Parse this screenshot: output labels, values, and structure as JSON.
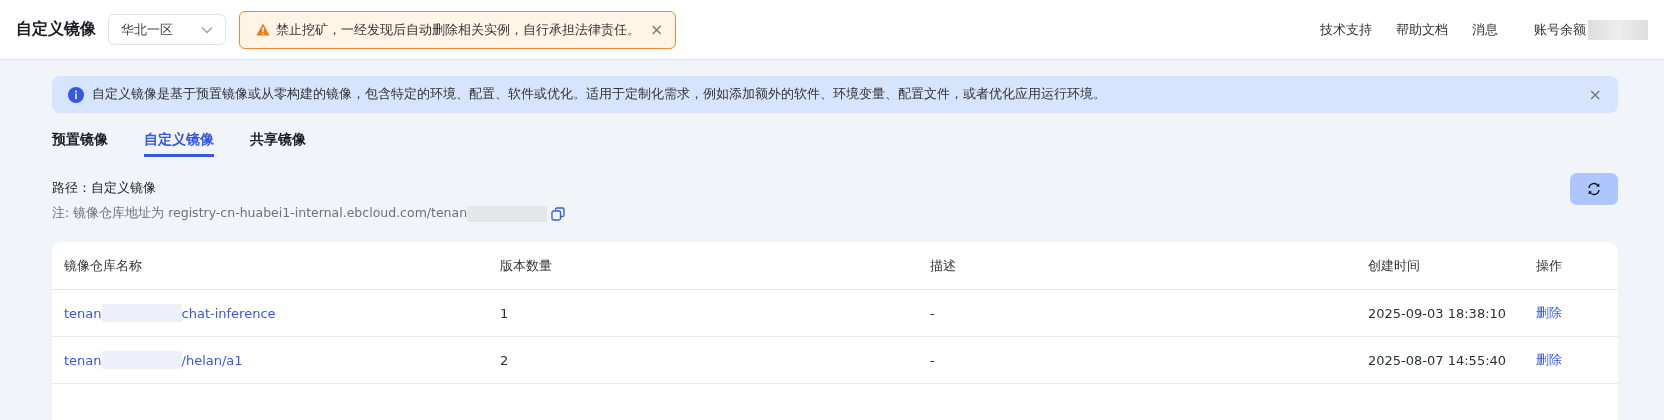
{
  "header": {
    "title": "自定义镜像",
    "region": {
      "value": "华北一区"
    },
    "warning": {
      "text": "禁止挖矿，一经发现后自动删除相关实例，自行承担法律责任。",
      "close": "×"
    },
    "nav": [
      "技术支持",
      "帮助文档",
      "消息"
    ],
    "account": {
      "label": "账号余额"
    }
  },
  "info": {
    "text": "自定义镜像是基于预置镜像或从零构建的镜像，包含特定的环境、配置、软件或优化。适用于定制化需求，例如添加额外的软件、环境变量、配置文件，或者优化应用运行环境。",
    "close": "×"
  },
  "tabs": [
    {
      "label": "预置镜像",
      "selected": false
    },
    {
      "label": "自定义镜像",
      "selected": true
    },
    {
      "label": "共享镜像",
      "selected": false
    }
  ],
  "path": {
    "label": "路径：",
    "value": "自定义镜像"
  },
  "note": "注: 镜像仓库地址为 registry-cn-huabei1-internal.ebcloud.com/tenan",
  "table": {
    "columns": [
      "镜像仓库名称",
      "版本数量",
      "描述",
      "创建时间",
      "操作"
    ],
    "rows": [
      {
        "name_start": "tenan",
        "name_end": "chat-inference",
        "versions": "1",
        "description": "-",
        "created": "2025-09-03 18:38:10",
        "action": "删除"
      },
      {
        "name_start": "tenan",
        "name_end": "/helan/a1",
        "versions": "2",
        "description": "-",
        "created": "2025-08-07 14:55:40",
        "action": "删除"
      }
    ]
  }
}
